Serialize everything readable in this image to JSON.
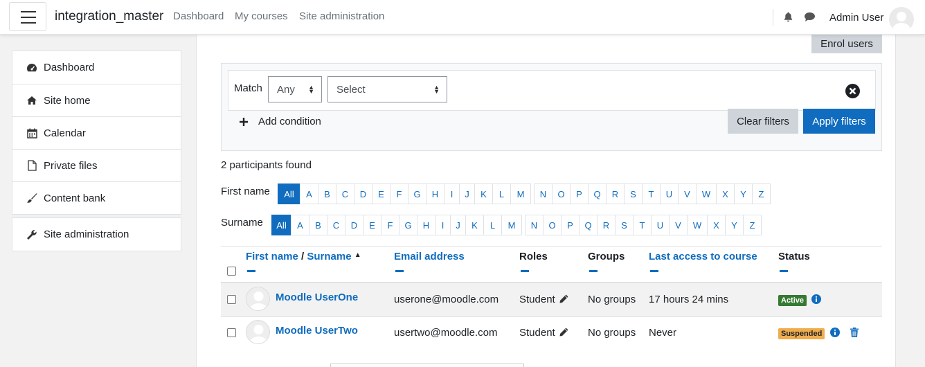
{
  "navbar": {
    "site_name": "integration_master",
    "links": [
      "Dashboard",
      "My courses",
      "Site administration"
    ],
    "user_name": "Admin User"
  },
  "sidebar": {
    "items": [
      {
        "label": "Dashboard",
        "icon": "dashboard-icon"
      },
      {
        "label": "Site home",
        "icon": "home-icon"
      },
      {
        "label": "Calendar",
        "icon": "calendar-icon"
      },
      {
        "label": "Private files",
        "icon": "file-icon"
      },
      {
        "label": "Content bank",
        "icon": "paintbrush-icon"
      }
    ],
    "admin_item": {
      "label": "Site administration",
      "icon": "wrench-icon"
    }
  },
  "main": {
    "enrol_button": "Enrol users",
    "filter": {
      "match_label": "Match",
      "match_value": "Any",
      "type_value": "Select",
      "add_condition": "Add condition",
      "clear_button": "Clear filters",
      "apply_button": "Apply filters"
    },
    "participants_found": "2 participants found",
    "firstname_label": "First name",
    "surname_label": "Surname",
    "letters": [
      "All",
      "A",
      "B",
      "C",
      "D",
      "E",
      "F",
      "G",
      "H",
      "I",
      "J",
      "K",
      "L",
      "M",
      "N",
      "O",
      "P",
      "Q",
      "R",
      "S",
      "T",
      "U",
      "V",
      "W",
      "X",
      "Y",
      "Z"
    ],
    "table": {
      "headers": {
        "first_name": "First name",
        "separator": "/",
        "surname": "Surname",
        "email": "Email address",
        "roles": "Roles",
        "groups": "Groups",
        "last_access": "Last access to course",
        "status": "Status"
      },
      "rows": [
        {
          "name": "Moodle UserOne",
          "email": "userone@moodle.com",
          "role": "Student",
          "groups": "No groups",
          "last_access": "17 hours 24 mins",
          "status": "Active"
        },
        {
          "name": "Moodle UserTwo",
          "email": "usertwo@moodle.com",
          "role": "Student",
          "groups": "No groups",
          "last_access": "Never",
          "status": "Suspended"
        }
      ]
    }
  },
  "colors": {
    "primary": "#0f6cbf",
    "active_badge": "#357a32",
    "suspended_badge": "#f0ad4e"
  }
}
